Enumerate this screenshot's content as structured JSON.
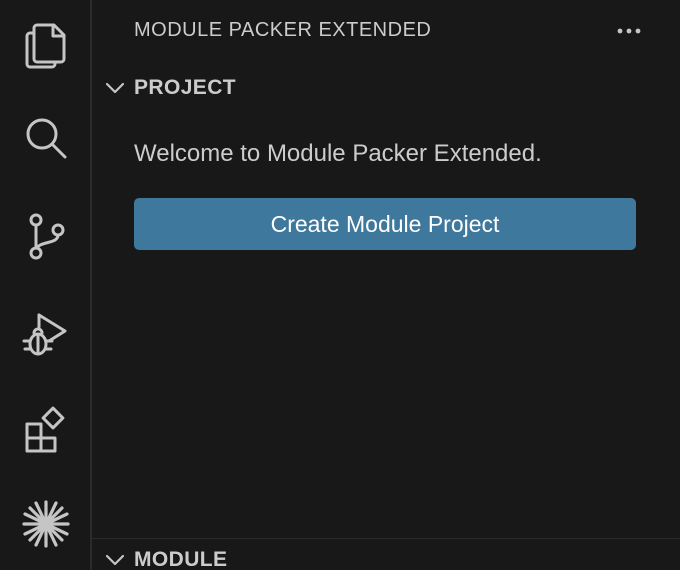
{
  "activity_bar": {
    "icons": [
      "files-icon",
      "search-icon",
      "source-control-icon",
      "run-debug-icon",
      "extensions-icon",
      "module-packer-icon"
    ]
  },
  "sidebar": {
    "title": "MODULE PACKER EXTENDED",
    "more_actions": "···",
    "sections": {
      "project": {
        "label": "PROJECT",
        "expanded": true,
        "welcome": "Welcome to Module Packer Extended.",
        "button_label": "Create Module Project"
      },
      "module": {
        "label": "MODULE",
        "expanded": true
      }
    }
  },
  "colors": {
    "background": "#181818",
    "text": "#cccccc",
    "icon": "#cccccc",
    "button": "#3e789d",
    "button_text": "#ffffff",
    "border": "#2b2b2b"
  }
}
